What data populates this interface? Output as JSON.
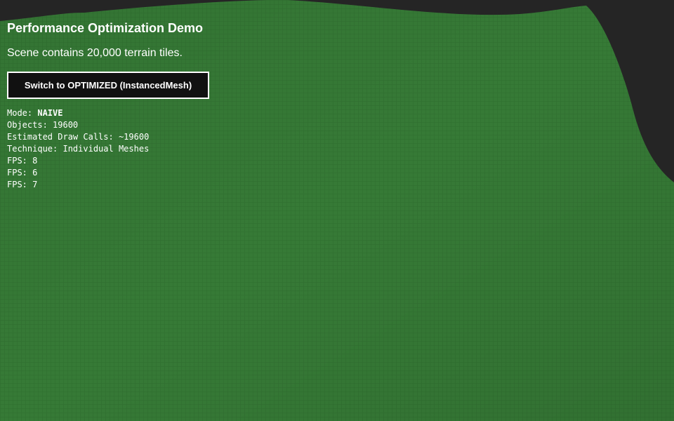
{
  "header": {
    "title": "Performance Optimization Demo",
    "subtitle": "Scene contains 20,000 terrain tiles."
  },
  "controls": {
    "switch_button_label": "Switch to OPTIMIZED (InstancedMesh)"
  },
  "stats": {
    "mode_label": "Mode: ",
    "mode_value": "NAIVE",
    "objects": "Objects: 19600",
    "draw_calls": "Estimated Draw Calls: ~19600",
    "technique": "Technique: Individual Meshes",
    "fps_lines": [
      "FPS: 8",
      "FPS: 6",
      "FPS: 7"
    ]
  },
  "colors": {
    "background": "#252525",
    "terrain": "#367a36",
    "terrain_grid": "#2f6d2f",
    "text": "#ffffff",
    "button_bg": "#111111"
  }
}
